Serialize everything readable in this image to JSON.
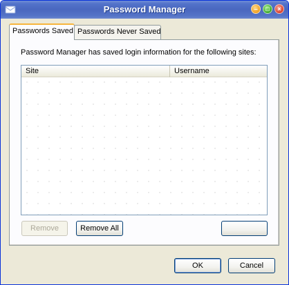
{
  "window": {
    "title": "Password Manager",
    "icon": "envelope-icon",
    "controls": [
      "minimize",
      "maximize",
      "close"
    ]
  },
  "tabs": [
    {
      "label": "Passwords Saved",
      "active": true
    },
    {
      "label": "Passwords Never Saved",
      "active": false
    }
  ],
  "panel": {
    "description": "Password Manager has saved login information for the following sites:",
    "columns": [
      "Site",
      "Username"
    ],
    "rows": []
  },
  "panel_buttons": {
    "remove": "Remove",
    "remove_all": "Remove All",
    "blank": ""
  },
  "dialog_buttons": {
    "ok": "OK",
    "cancel": "Cancel"
  },
  "colors": {
    "titlebar": "#4a67bf",
    "dialog_bg": "#ece9d8",
    "active_tab_accent": "#f7b43b"
  }
}
